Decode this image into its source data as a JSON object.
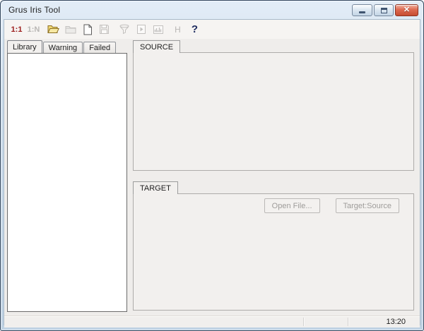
{
  "window": {
    "title": "Grus Iris Tool",
    "controls": [
      "minimize",
      "maximize",
      "close"
    ]
  },
  "toolbar": {
    "items": [
      {
        "name": "match-one-to-one",
        "label": "1:1",
        "enabled": true,
        "color": "#9c1c1c"
      },
      {
        "name": "match-one-to-many",
        "label": "1:N",
        "enabled": false
      },
      {
        "name": "open-file",
        "icon": "folder-open-icon",
        "enabled": true
      },
      {
        "name": "import-folder",
        "icon": "folder-icon",
        "enabled": false
      },
      {
        "name": "new-document",
        "icon": "new-document-icon",
        "enabled": true
      },
      {
        "name": "save",
        "icon": "save-icon",
        "enabled": false
      },
      {
        "name": "filter",
        "icon": "funnel-icon",
        "enabled": false
      },
      {
        "name": "run",
        "icon": "run-document-icon",
        "enabled": false
      },
      {
        "name": "histogram",
        "icon": "bar-chart-icon",
        "enabled": false
      },
      {
        "name": "h-tool",
        "label": "H",
        "enabled": false
      },
      {
        "name": "help",
        "label": "?",
        "enabled": true,
        "color": "#1c2a5e"
      }
    ]
  },
  "sidebar": {
    "tabs": [
      {
        "label": "Library",
        "active": true
      },
      {
        "label": "Warning",
        "active": false
      },
      {
        "label": "Failed",
        "active": false
      }
    ]
  },
  "source_panel": {
    "title": "SOURCE"
  },
  "target_panel": {
    "title": "TARGET",
    "open_file_label": "Open File...",
    "target_source_label": "Target:Source"
  },
  "status_bar": {
    "time": "13:20"
  },
  "colors": {
    "accent_red": "#9c1c1c",
    "help_blue": "#1c2a5e",
    "folder_yellow": "#f0d875",
    "close_button_red": "#dd6950",
    "frame_blue": "#c7d8e7"
  }
}
